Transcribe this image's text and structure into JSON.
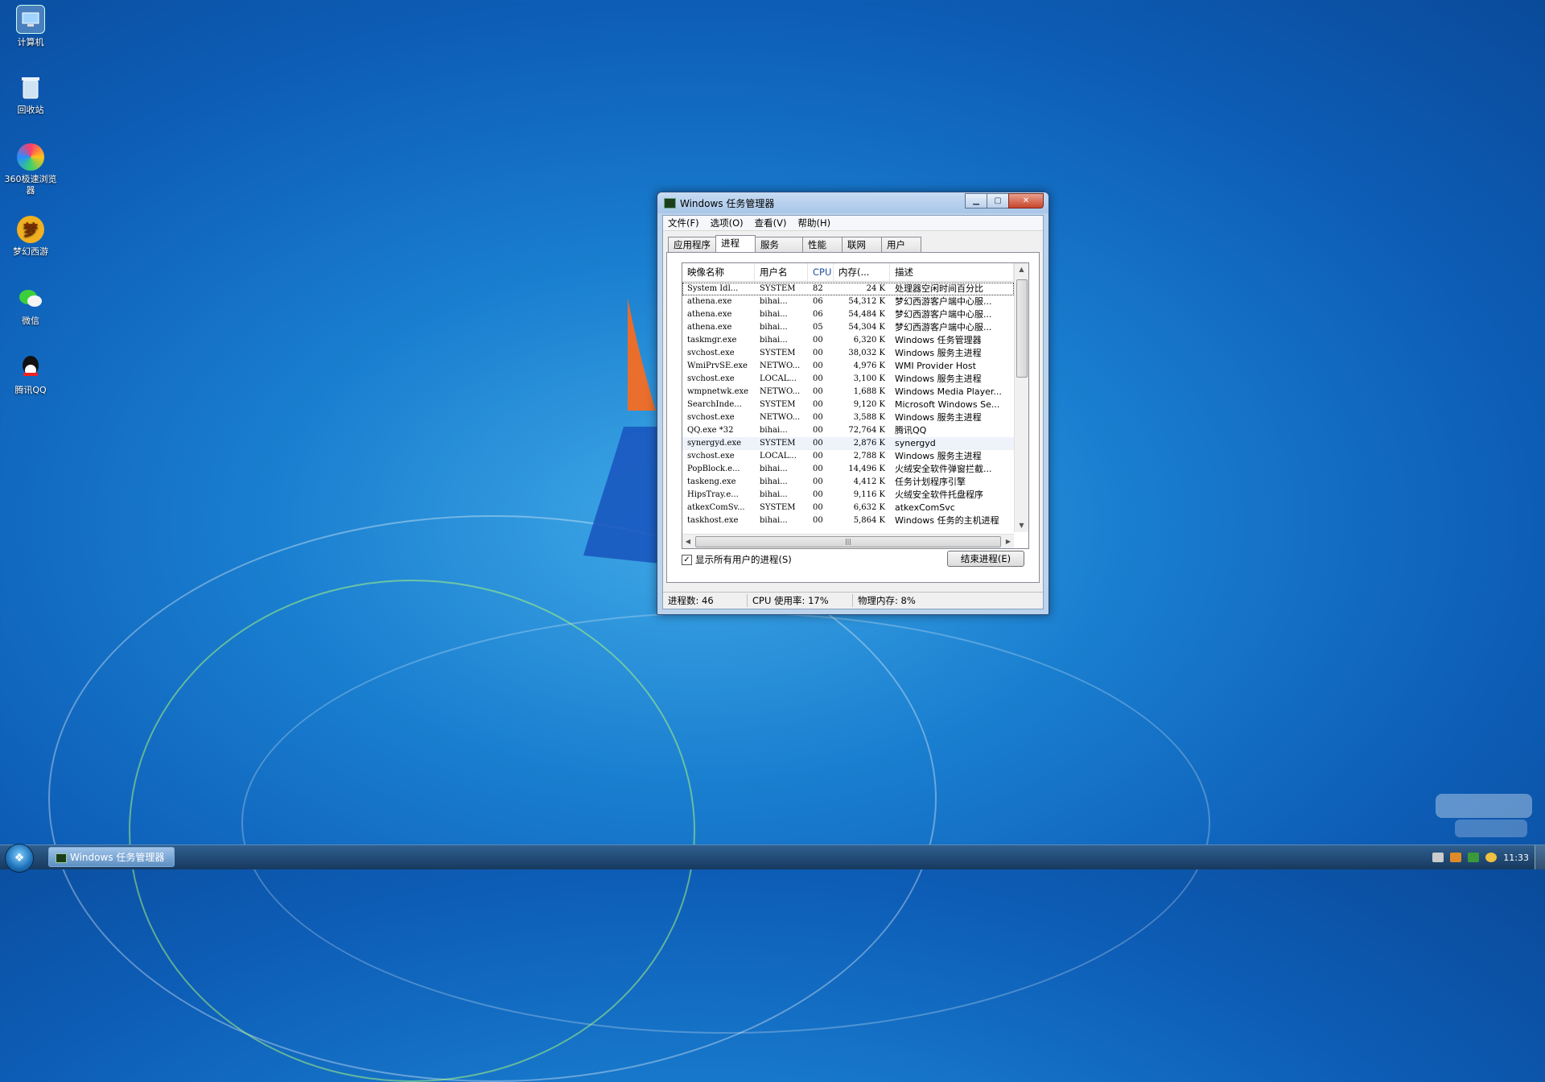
{
  "desktop": {
    "icons": [
      {
        "label": "计算机",
        "icon": "computer-icon"
      },
      {
        "label": "回收站",
        "icon": "recycle-bin-icon"
      },
      {
        "label": "360极速浏览器",
        "icon": "browser-360-icon"
      },
      {
        "label": "梦幻西游",
        "icon": "game-icon"
      },
      {
        "label": "微信",
        "icon": "wechat-icon"
      },
      {
        "label": "腾讯QQ",
        "icon": "qq-icon"
      }
    ]
  },
  "window": {
    "title": "Windows 任务管理器",
    "menu": [
      "文件(F)",
      "选项(O)",
      "查看(V)",
      "帮助(H)"
    ],
    "tabs": [
      "应用程序",
      "进程",
      "服务",
      "性能",
      "联网",
      "用户"
    ],
    "active_tab": "进程",
    "columns": [
      "映像名称",
      "用户名",
      "CPU",
      "内存(...",
      "描述"
    ],
    "rows": [
      [
        "System Idl...",
        "SYSTEM",
        "82",
        "24 K",
        "处理器空闲时间百分比"
      ],
      [
        "athena.exe",
        "bihai...",
        "06",
        "54,312 K",
        "梦幻西游客户端中心服..."
      ],
      [
        "athena.exe",
        "bihai...",
        "06",
        "54,484 K",
        "梦幻西游客户端中心服..."
      ],
      [
        "athena.exe",
        "bihai...",
        "05",
        "54,304 K",
        "梦幻西游客户端中心服..."
      ],
      [
        "taskmgr.exe",
        "bihai...",
        "00",
        "6,320 K",
        "Windows 任务管理器"
      ],
      [
        "svchost.exe",
        "SYSTEM",
        "00",
        "38,032 K",
        "Windows 服务主进程"
      ],
      [
        "WmiPrvSE.exe",
        "NETWO...",
        "00",
        "4,976 K",
        "WMI Provider Host"
      ],
      [
        "svchost.exe",
        "LOCAL...",
        "00",
        "3,100 K",
        "Windows 服务主进程"
      ],
      [
        "wmpnetwk.exe",
        "NETWO...",
        "00",
        "1,688 K",
        "Windows Media Player..."
      ],
      [
        "SearchInde...",
        "SYSTEM",
        "00",
        "9,120 K",
        "Microsoft Windows Se..."
      ],
      [
        "svchost.exe",
        "NETWO...",
        "00",
        "3,588 K",
        "Windows 服务主进程"
      ],
      [
        "QQ.exe *32",
        "bihai...",
        "00",
        "72,764 K",
        "腾讯QQ"
      ],
      [
        "synergyd.exe",
        "SYSTEM",
        "00",
        "2,876 K",
        "synergyd"
      ],
      [
        "svchost.exe",
        "LOCAL...",
        "00",
        "2,788 K",
        "Windows 服务主进程"
      ],
      [
        "PopBlock.e...",
        "bihai...",
        "00",
        "14,496 K",
        "火绒安全软件弹窗拦截..."
      ],
      [
        "taskeng.exe",
        "bihai...",
        "00",
        "4,412 K",
        "任务计划程序引擎"
      ],
      [
        "HipsTray.e...",
        "bihai...",
        "00",
        "9,116 K",
        "火绒安全软件托盘程序"
      ],
      [
        "atkexComSv...",
        "SYSTEM",
        "00",
        "6,632 K",
        "atkexComSvc"
      ],
      [
        "taskhost.exe",
        "bihai...",
        "00",
        "5,864 K",
        "Windows 任务的主机进程"
      ]
    ],
    "show_all_users": "显示所有用户的进程(S)",
    "end_process": "结束进程(E)",
    "status": {
      "processes": "进程数: 46",
      "cpu": "CPU 使用率: 17%",
      "memory": "物理内存: 8%"
    }
  },
  "taskbar": {
    "task": "Windows 任务管理器",
    "clock": "11:33"
  }
}
